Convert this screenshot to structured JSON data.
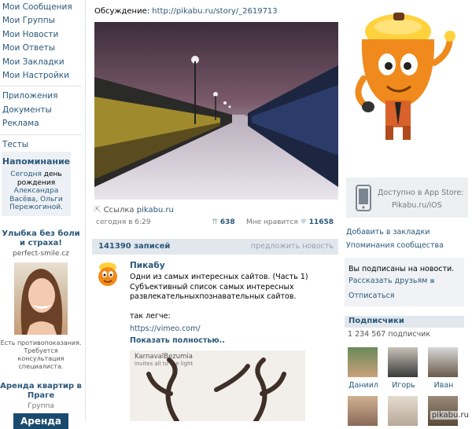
{
  "nav": {
    "items1": [
      "Мои Сообщения",
      "Мои Группы",
      "Мои Новости",
      "Мои Ответы",
      "Мои Закладки",
      "Мои Настройки"
    ],
    "items2": [
      "Приложения",
      "Документы",
      "Реклама"
    ],
    "items3": [
      "Тесты"
    ]
  },
  "reminder": {
    "title": "Напоминание",
    "today": "Сегодня",
    "birthday": "день рождения",
    "names": "Александра Васёва, Ольги Пережогиной."
  },
  "ad1": {
    "title": "Улыбка без боли и страха!",
    "domain": "perfect-smile.cz",
    "disclaimer": "Есть противопоказания. Требуется консультация специалиста."
  },
  "ad2": {
    "title": "Аренда квартир в Праге",
    "type": "Группа",
    "img_text": "Аренда"
  },
  "post_top": {
    "discussion_label": "Обсуждение:",
    "discussion_url": "http://pikabu.ru/story/_2619713",
    "link_label": "Ссылка",
    "link_domain": "pikabu.ru",
    "time": "сегодня в 6:29",
    "reposts": "638",
    "like_label": "Мне нравится",
    "likes": "11658"
  },
  "wall": {
    "count": "141390 записей",
    "suggest": "предложить новость"
  },
  "post": {
    "author": "Пикабу",
    "text_line1": "Одни из самых интересных сайтов. (Часть 1)",
    "text_line2": "Субъективный список самых интересных",
    "text_line3": "развлекательныхпознавательных сайтов.",
    "text_line4": "так легче:",
    "vimeo": "https://vimeo.com/",
    "show_more": "Показать полностью..",
    "img_caption": "KarnavalBezumia",
    "img_subcaption": "invites all to the light"
  },
  "right": {
    "appstore_line1": "Доступно в App Store:",
    "appstore_line2": "Pikabu.ru/iOS",
    "bookmark": "Добавить в закладки",
    "mentions": "Упоминания сообщества",
    "subscribed": "Вы подписаны на новости.",
    "tell_friends": "Рассказать друзьям",
    "unsubscribe": "Отписаться",
    "subscribers_title": "Подписчики",
    "subscribers_count": "1 234 567 подписчик",
    "friends": [
      "Даниил",
      "Игорь",
      "Иван"
    ]
  },
  "watermark": "pikabu.ru"
}
